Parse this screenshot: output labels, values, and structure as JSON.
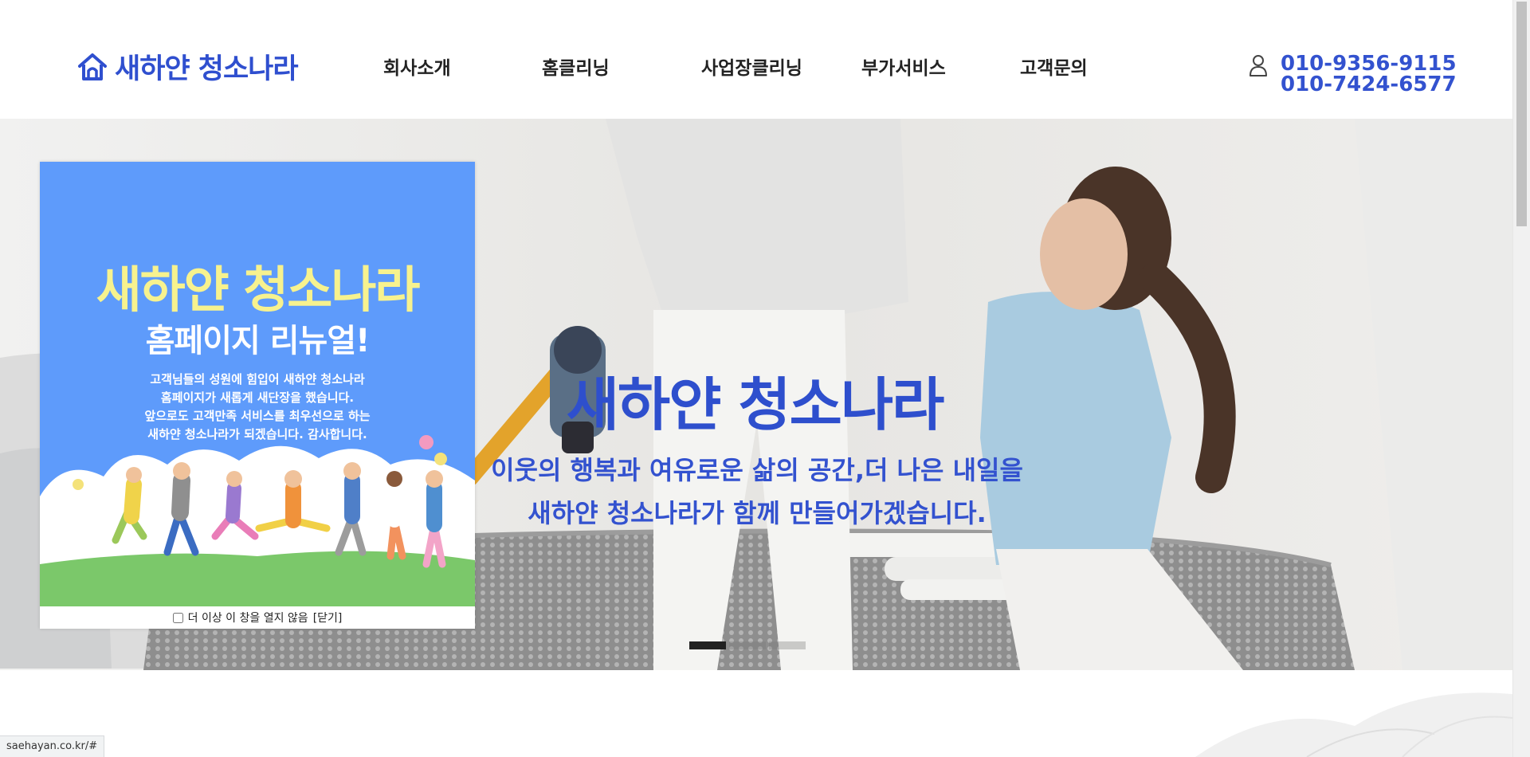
{
  "header": {
    "logo_text": "새하얀 청소나라",
    "nav": [
      "회사소개",
      "홈클리닝",
      "사업장클리닝",
      "부가서비스",
      "고객문의"
    ],
    "phones": [
      "010-9356-9115",
      "010-7424-6577"
    ]
  },
  "hero": {
    "title": "새하얀 청소나라",
    "subtitle_line1": "이웃의 행복과 여유로운 삶의 공간,더 나은 내일을",
    "subtitle_line2": "새하얀 청소나라가 함께 만들어가겠습니다.",
    "slide_count": 3,
    "active_slide": 1
  },
  "popup": {
    "title": "새하얀 청소나라",
    "subtitle": "홈페이지 리뉴얼!",
    "body": [
      "고객님들의 성원에 힘입어 새하얀 청소나라",
      "홈페이지가 새롭게 새단장을 했습니다.",
      "앞으로도 고객만족 서비스를 최우선으로 하는",
      "새하얀 청소나라가 되겠습니다. 감사합니다."
    ],
    "checkbox_label": "더 이상 이 창을 열지 않음",
    "close_label": "[닫기]"
  },
  "status_url": "saehayan.co.kr/#",
  "colors": {
    "brand_blue": "#2f4fcf",
    "popup_blue": "#5e9bfb",
    "popup_title_yellow": "#f7f28e"
  }
}
